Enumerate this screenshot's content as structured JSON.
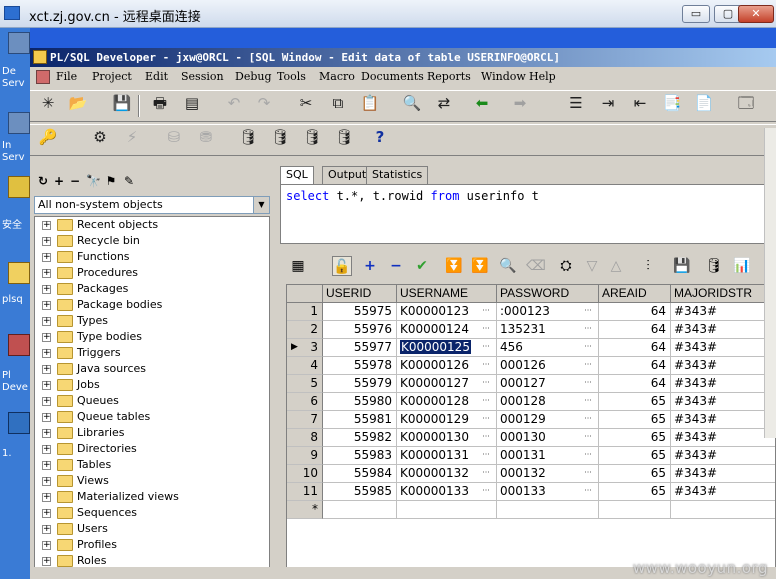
{
  "remote_window": {
    "title": "xct.zj.gov.cn - 远程桌面连接",
    "buttons": [
      "▭",
      "▢",
      "✕"
    ]
  },
  "desktop_labels": [
    "De",
    "Serv",
    "In",
    "Serv",
    "安全",
    "plsq",
    "Pl",
    "Deve",
    "1."
  ],
  "app": {
    "title": "PL/SQL Developer - jxw@ORCL - [SQL Window - Edit data of table USERINFO@ORCL]",
    "menu": [
      "File",
      "Project",
      "Edit",
      "Session",
      "Debug",
      "Tools",
      "Macro",
      "Documents",
      "Reports",
      "Window",
      "Help"
    ]
  },
  "object_browser": {
    "filter": "All non-system objects",
    "items": [
      "Recent objects",
      "Recycle bin",
      "Functions",
      "Procedures",
      "Packages",
      "Package bodies",
      "Types",
      "Type bodies",
      "Triggers",
      "Java sources",
      "Jobs",
      "Queues",
      "Queue tables",
      "Libraries",
      "Directories",
      "Tables",
      "Views",
      "Materialized views",
      "Sequences",
      "Users",
      "Profiles",
      "Roles"
    ]
  },
  "sql_window": {
    "tabs": [
      "SQL",
      "Output",
      "Statistics"
    ],
    "sql_parts": {
      "kw1": "select",
      "mid1": " t.*, t.rowid ",
      "kw2": "from",
      "mid2": " userinfo t"
    }
  },
  "grid": {
    "columns": [
      "USERID",
      "USERNAME",
      "PASSWORD",
      "AREAID",
      "MAJORIDSTR"
    ],
    "rows": [
      [
        "1",
        "55975",
        "K00000123",
        ":000123",
        "64",
        "#343#"
      ],
      [
        "2",
        "55976",
        "K00000124",
        "135231",
        "64",
        "#343#"
      ],
      [
        "3",
        "55977",
        "K00000125",
        "456",
        "64",
        "#343#"
      ],
      [
        "4",
        "55978",
        "K00000126",
        "000126",
        "64",
        "#343#"
      ],
      [
        "5",
        "55979",
        "K00000127",
        "000127",
        "64",
        "#343#"
      ],
      [
        "6",
        "55980",
        "K00000128",
        "000128",
        "65",
        "#343#"
      ],
      [
        "7",
        "55981",
        "K00000129",
        "000129",
        "65",
        "#343#"
      ],
      [
        "8",
        "55982",
        "K00000130",
        "000130",
        "65",
        "#343#"
      ],
      [
        "9",
        "55983",
        "K00000131",
        "000131",
        "65",
        "#343#"
      ],
      [
        "10",
        "55984",
        "K00000132",
        "000132",
        "65",
        "#343#"
      ],
      [
        "11",
        "55985",
        "K00000133",
        "000133",
        "65",
        "#343#"
      ]
    ],
    "new_row_marker": "*",
    "current_row_marker": "▶"
  },
  "watermark": "www.wooyun.org"
}
